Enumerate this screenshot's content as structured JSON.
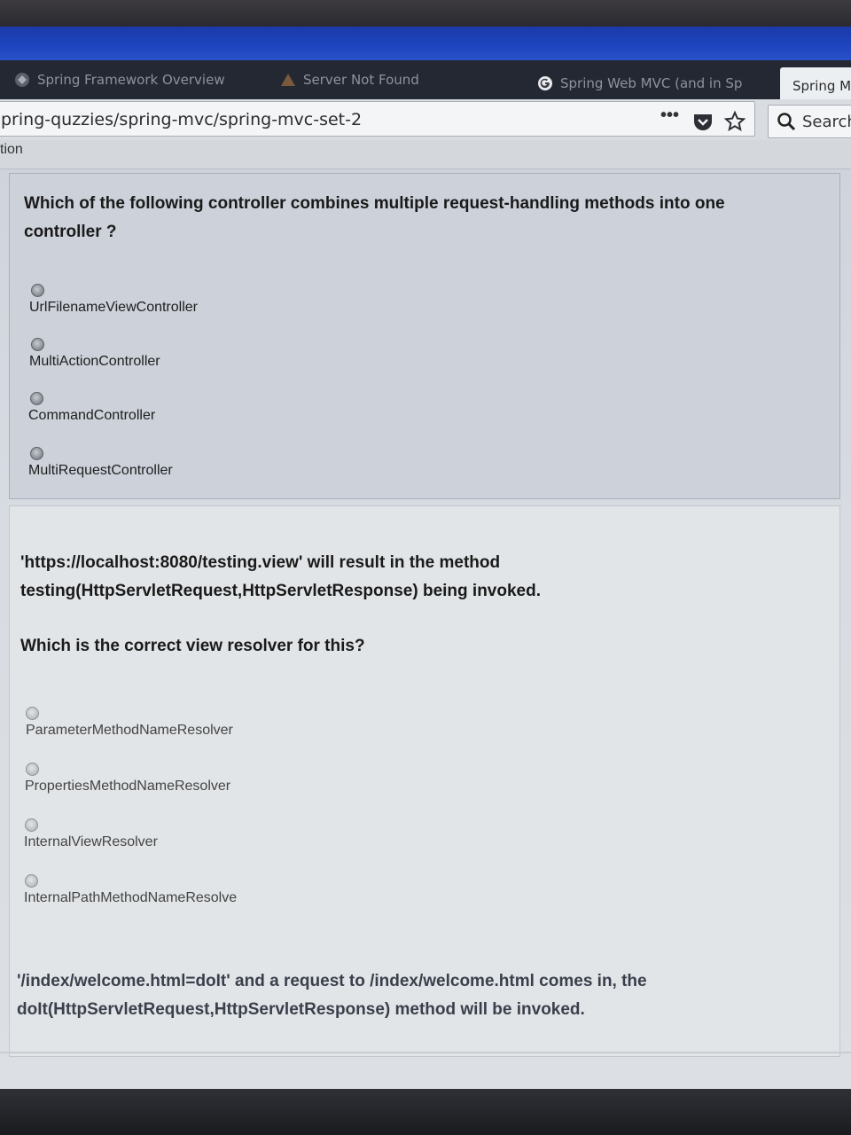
{
  "browser": {
    "tabs": [
      {
        "label": "Spring Framework Overview",
        "icon": "spring-favicon"
      },
      {
        "label": "Server Not Found",
        "icon": "warning-icon"
      },
      {
        "label": "Spring Web MVC (and in Sp",
        "icon": "google-icon"
      },
      {
        "label": "Spring MV",
        "icon": ""
      }
    ],
    "url": "pring-quzzies/spring-mvc/spring-mvc-set-2",
    "menu_label": "•••",
    "search_placeholder": "Search",
    "bookmark_text": "tion"
  },
  "question1": {
    "text": "Which of the following controller  combines multiple request-handling methods into one controller ?",
    "options": [
      "UrlFilenameViewController",
      "MultiActionController",
      "CommandController",
      "MultiRequestController"
    ]
  },
  "question2": {
    "statement": "'https://localhost:8080/testing.view' will result in the method testing(HttpServletRequest,HttpServletResponse) being invoked.",
    "question": "Which is the correct view resolver for this?",
    "options": [
      "ParameterMethodNameResolver",
      "PropertiesMethodNameResolver",
      "InternalViewResolver",
      "InternalPathMethodNameResolve"
    ],
    "footer_text": "'/index/welcome.html=doIt' and a request to /index/welcome.html comes in, the doIt(HttpServletRequest,HttpServletResponse) method will be invoked."
  },
  "colors": {
    "titlebar": "#1f46c0",
    "tabstrip": "#242833",
    "active_tab": "#eceff2",
    "question_bg": "#ccd1da"
  }
}
